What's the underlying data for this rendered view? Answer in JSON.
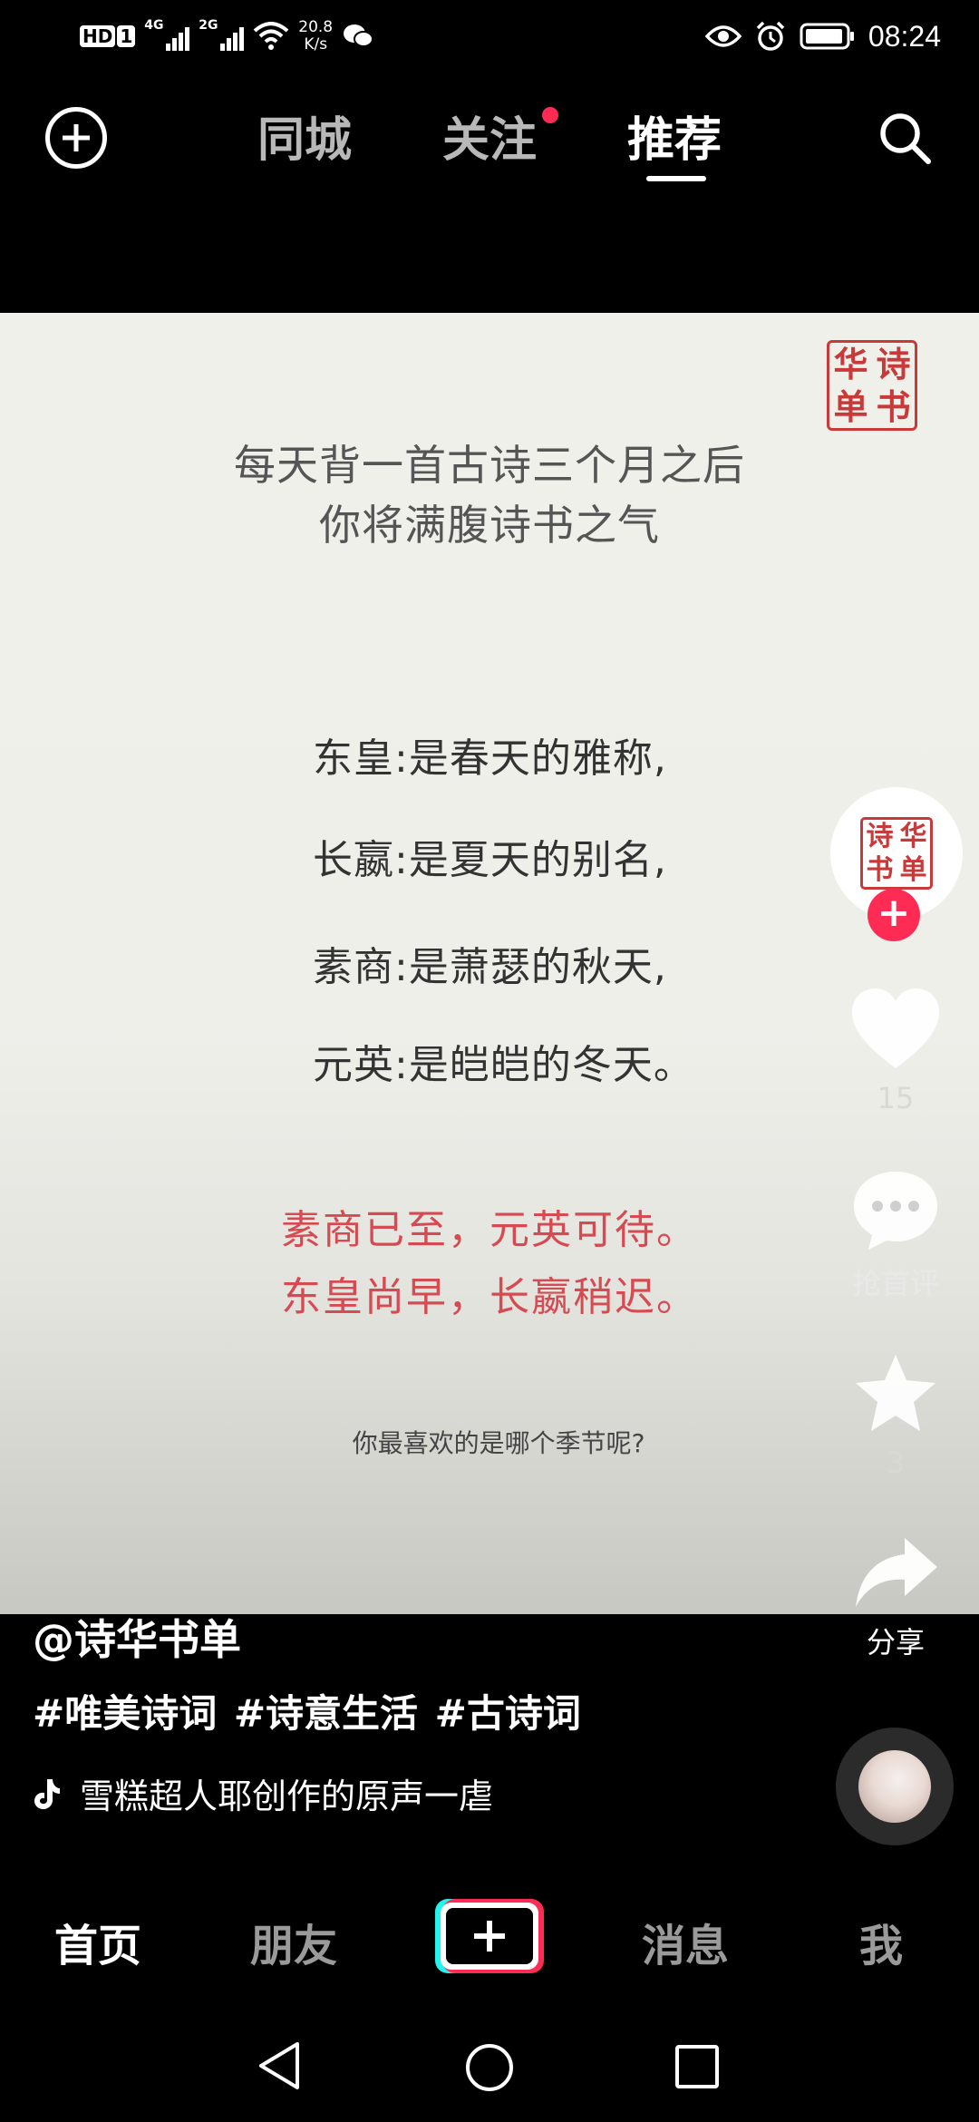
{
  "status_bar": {
    "hd": "HD",
    "sim": "1",
    "sig1": "4G",
    "sig2": "2G",
    "speed_value": "20.8",
    "speed_unit": "K/s",
    "time": "08:24"
  },
  "top_nav": {
    "tabs": [
      "同城",
      "关注",
      "推荐"
    ],
    "active_tab": "推荐"
  },
  "video": {
    "seal_chars": [
      "诗",
      "华",
      "书",
      "单"
    ],
    "headline": [
      "每天背一首古诗三个月之后",
      "你将满腹诗书之气"
    ],
    "definitions": [
      "东皇:是春天的雅称,",
      "长嬴:是夏天的别名,",
      "素商:是萧瑟的秋天,",
      "元英:是皑皑的冬天。"
    ],
    "red_lines": [
      "素商已至，元英可待。",
      "东皇尚早，长嬴稍迟。"
    ],
    "question": "你最喜欢的是哪个季节呢?"
  },
  "rail": {
    "likes": "15",
    "comments": "抢首评",
    "favorites": "3",
    "share": "分享"
  },
  "caption": {
    "author": "@诗华书单",
    "tags": "#唯美诗词 #诗意生活 #古诗词",
    "music": "雪糕超人耶创作的原声一虐"
  },
  "bottom_tabs": {
    "home": "首页",
    "friends": "朋友",
    "messages": "消息",
    "me": "我"
  },
  "colors": {
    "accent": "#fe2c55",
    "accent2": "#25f4ee",
    "seal_red": "#c83a3a",
    "poem_red": "#d64a52"
  }
}
